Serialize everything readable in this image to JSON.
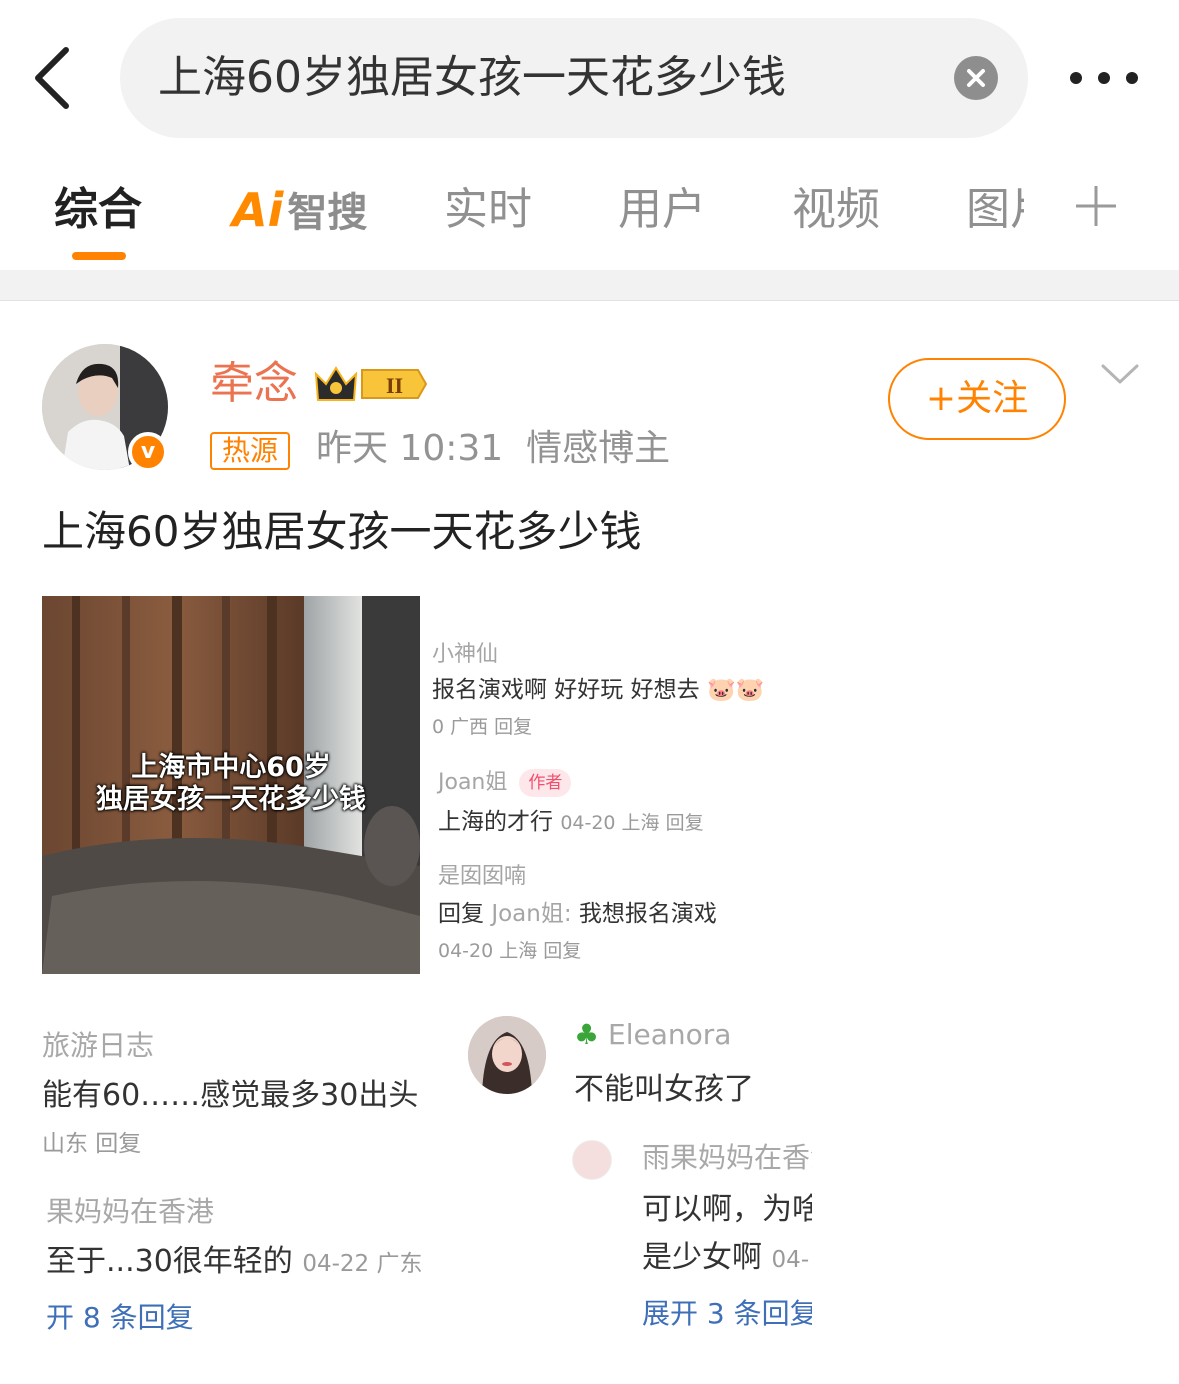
{
  "search": {
    "query": "上海60岁独居女孩一天花多少钱"
  },
  "tabs": {
    "comprehensive": "综合",
    "ai_logo": "Ai",
    "ai_label": "智搜",
    "realtime": "实时",
    "users": "用户",
    "video": "视频",
    "image": "图片"
  },
  "post": {
    "username": "牵念",
    "level_badge": "II",
    "hot_badge": "热源",
    "time": "昨天 10:31",
    "category": "情感博主",
    "follow_label": "+关注",
    "text": "上海60岁独居女孩一天花多少钱"
  },
  "embedded": {
    "video_caption_line1": "上海市中心60岁",
    "video_caption_line2": "独居女孩一天花多少钱",
    "comments": [
      {
        "name": "小神仙",
        "text": "报名演戏啊 好好玩 好想去",
        "meta": "0 广西 回复"
      },
      {
        "name": "Joan姐",
        "tag": "作者",
        "text": "上海的才行",
        "meta": "04-20 上海 回复"
      },
      {
        "name": "是囡囡喃",
        "text_prefix": "回复",
        "text_mention": "Joan姐:",
        "text": "我想报名演戏",
        "meta": "04-20 上海 回复"
      }
    ],
    "left_thread": {
      "name": "旅游日志",
      "text": "能有60……感觉最多30出头",
      "meta": "山东 回复",
      "reply_name": "果妈妈在香港",
      "reply_text": "至于...30很年轻的",
      "reply_meta": "04-22 广东",
      "expand": "开 8 条回复"
    },
    "right_thread": {
      "name": "Eleanora",
      "text": "不能叫女孩了",
      "reply_name": "雨果妈妈在香港",
      "reply_text_1": "可以啊，为啥",
      "reply_text_2": "是少女啊",
      "reply_meta": "04-",
      "expand": "展开 3 条回复"
    }
  },
  "colors": {
    "accent": "#ff8200",
    "username": "#eb7350",
    "link": "#3e6fb7"
  }
}
